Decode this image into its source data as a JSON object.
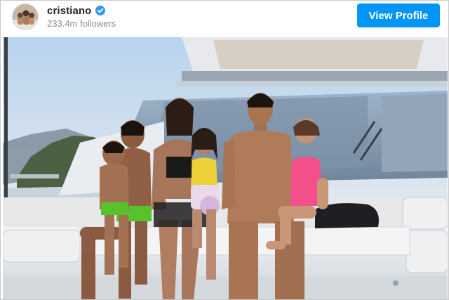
{
  "header": {
    "username": "cristiano",
    "followers_text": "233.4m followers",
    "view_profile_label": "View Profile"
  },
  "icons": {
    "verified": "verified-badge-icon",
    "avatar": "profile-avatar"
  },
  "colors": {
    "accent": "#0095f6",
    "verified": "#3897f0",
    "username": "#262626",
    "secondary_text": "#8e8e8e"
  }
}
